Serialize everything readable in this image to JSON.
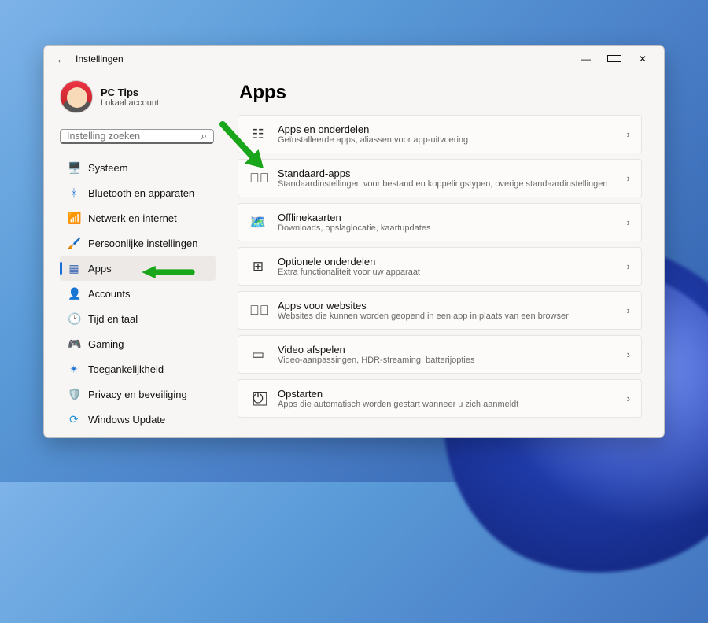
{
  "window": {
    "title": "Instellingen"
  },
  "user": {
    "name": "PC Tips",
    "sub": "Lokaal account"
  },
  "search": {
    "placeholder": "Instelling zoeken"
  },
  "nav": [
    {
      "icon": "🖥️",
      "label": "Systeem",
      "name": "sidebar-item-systeem"
    },
    {
      "icon": "ᚼ",
      "label": "Bluetooth en apparaten",
      "name": "sidebar-item-bluetooth",
      "c": "#1a6fd6"
    },
    {
      "icon": "📶",
      "label": "Netwerk en internet",
      "name": "sidebar-item-netwerk",
      "c": "#1a7fd6"
    },
    {
      "icon": "🖌️",
      "label": "Persoonlijke instellingen",
      "name": "sidebar-item-personalisatie"
    },
    {
      "icon": "▦",
      "label": "Apps",
      "name": "sidebar-item-apps",
      "selected": true,
      "c": "#3a64b3"
    },
    {
      "icon": "👤",
      "label": "Accounts",
      "name": "sidebar-item-accounts",
      "c": "#7aa54a"
    },
    {
      "icon": "🕑",
      "label": "Tijd en taal",
      "name": "sidebar-item-tijd-taal"
    },
    {
      "icon": "🎮",
      "label": "Gaming",
      "name": "sidebar-item-gaming",
      "c": "#777"
    },
    {
      "icon": "✴",
      "label": "Toegankelijkheid",
      "name": "sidebar-item-toegankelijkheid",
      "c": "#1a6fd6"
    },
    {
      "icon": "🛡️",
      "label": "Privacy en beveiliging",
      "name": "sidebar-item-privacy"
    },
    {
      "icon": "⟳",
      "label": "Windows Update",
      "name": "sidebar-item-update",
      "c": "#1a8fd6"
    }
  ],
  "main": {
    "heading": "Apps",
    "cards": [
      {
        "icon": "☷",
        "title": "Apps en onderdelen",
        "sub": "Geïnstalleerde apps, aliassen voor app-uitvoering",
        "name": "card-apps-onderdelen"
      },
      {
        "icon": "✔⃞",
        "title": "Standaard-apps",
        "sub": "Standaardinstellingen voor bestand en koppelingstypen, overige standaardinstellingen",
        "name": "card-standaard-apps"
      },
      {
        "icon": "🗺️",
        "title": "Offlinekaarten",
        "sub": "Downloads, opslaglocatie, kaartupdates",
        "name": "card-offlinekaarten"
      },
      {
        "icon": "⊞",
        "title": "Optionele onderdelen",
        "sub": "Extra functionaliteit voor uw apparaat",
        "name": "card-optionele-onderdelen"
      },
      {
        "icon": "↗⃞",
        "title": "Apps voor websites",
        "sub": "Websites die kunnen worden geopend in een app in plaats van een browser",
        "name": "card-apps-websites"
      },
      {
        "icon": "▭",
        "title": "Video afspelen",
        "sub": "Video-aanpassingen, HDR-streaming, batterijopties",
        "name": "card-video-afspelen"
      },
      {
        "icon": "⏻⃞",
        "title": "Opstarten",
        "sub": "Apps die automatisch worden gestart wanneer u zich aanmeldt",
        "name": "card-opstarten"
      }
    ]
  }
}
